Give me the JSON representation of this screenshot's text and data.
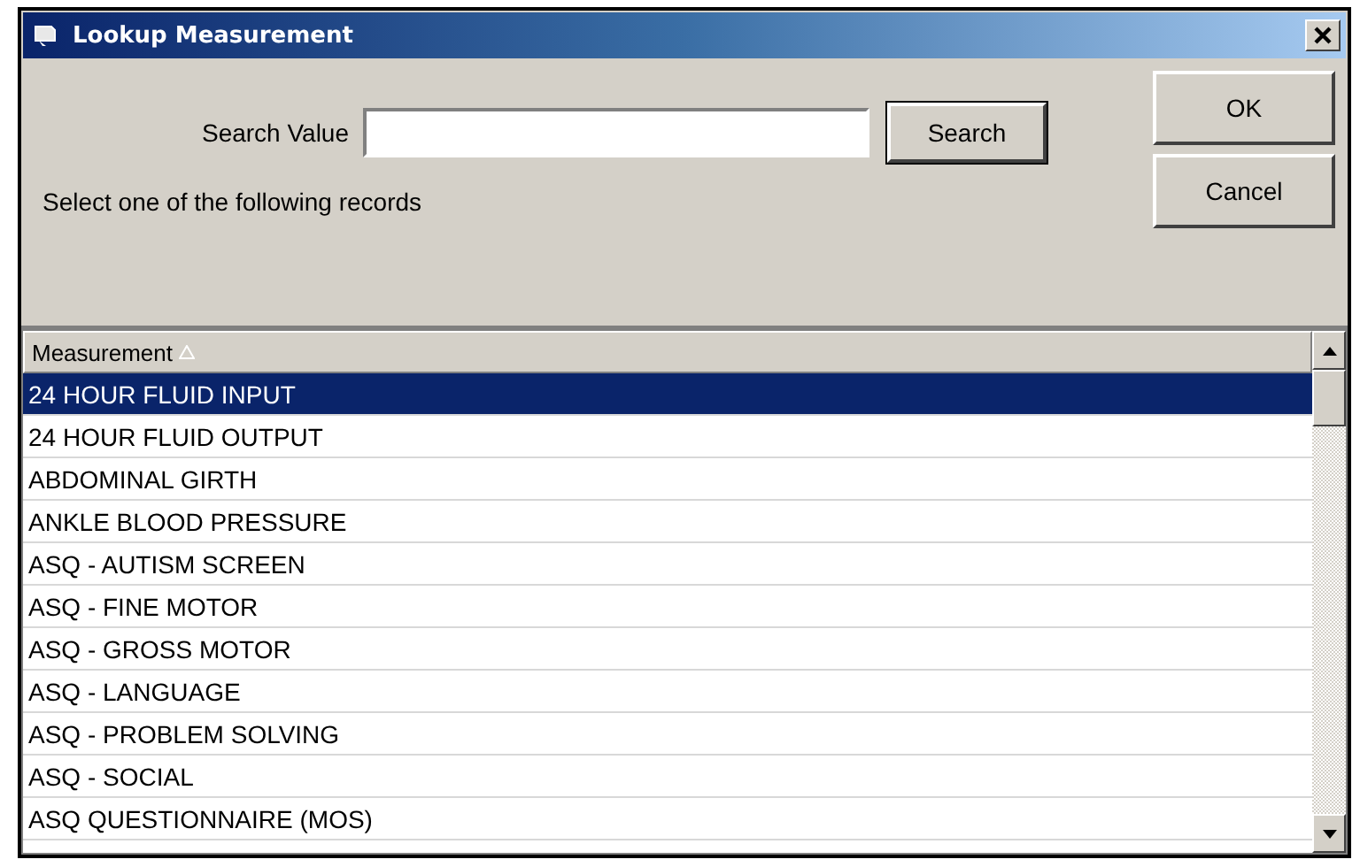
{
  "window": {
    "title": "Lookup Measurement"
  },
  "search": {
    "label": "Search Value"
  },
  "buttons": {
    "search": "Search",
    "ok": "OK",
    "cancel": "Cancel"
  },
  "instruction": "Select one of the following records",
  "table": {
    "columns": [
      {
        "label": "Measurement",
        "sorted": true
      }
    ],
    "rows": [
      {
        "label": "24 HOUR FLUID INPUT",
        "selected": true
      },
      {
        "label": "24 HOUR FLUID OUTPUT",
        "selected": false
      },
      {
        "label": "ABDOMINAL GIRTH",
        "selected": false
      },
      {
        "label": "ANKLE BLOOD PRESSURE",
        "selected": false
      },
      {
        "label": "ASQ - AUTISM SCREEN",
        "selected": false
      },
      {
        "label": "ASQ - FINE MOTOR",
        "selected": false
      },
      {
        "label": "ASQ - GROSS MOTOR",
        "selected": false
      },
      {
        "label": "ASQ - LANGUAGE",
        "selected": false
      },
      {
        "label": "ASQ - PROBLEM SOLVING",
        "selected": false
      },
      {
        "label": "ASQ - SOCIAL",
        "selected": false
      },
      {
        "label": "ASQ QUESTIONNAIRE (MOS)",
        "selected": false
      }
    ]
  }
}
